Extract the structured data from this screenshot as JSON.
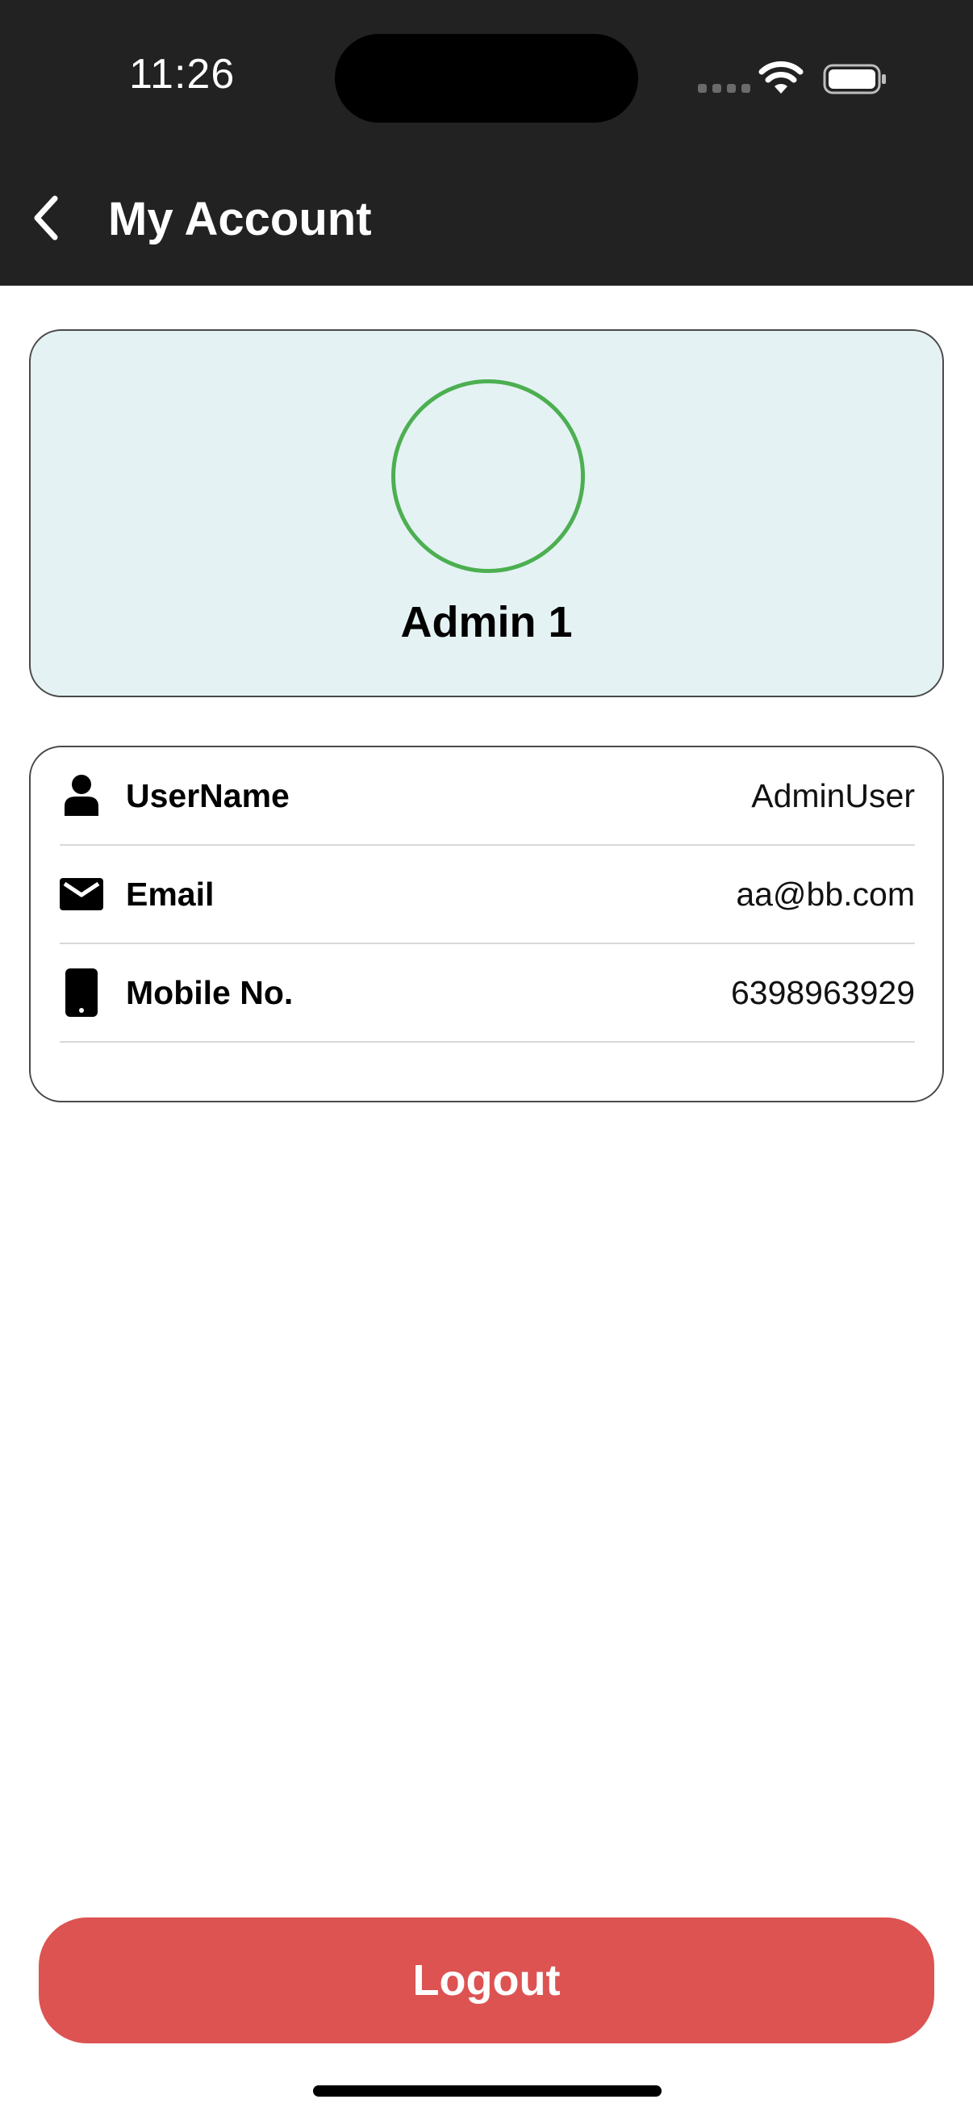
{
  "status_bar": {
    "time": "11:26"
  },
  "header": {
    "title": "My Account",
    "back_icon": "chevron-left-icon"
  },
  "profile": {
    "name": "Admin 1",
    "avatar_ring_color": "#4caf50",
    "card_background": "#e4f2f4"
  },
  "details": [
    {
      "icon": "person-icon",
      "label": "UserName",
      "value": "AdminUser"
    },
    {
      "icon": "mail-icon",
      "label": "Email",
      "value": "aa@bb.com"
    },
    {
      "icon": "phone-icon",
      "label": "Mobile No.",
      "value": "6398963929"
    }
  ],
  "logout": {
    "label": "Logout",
    "color": "#dc5352"
  }
}
